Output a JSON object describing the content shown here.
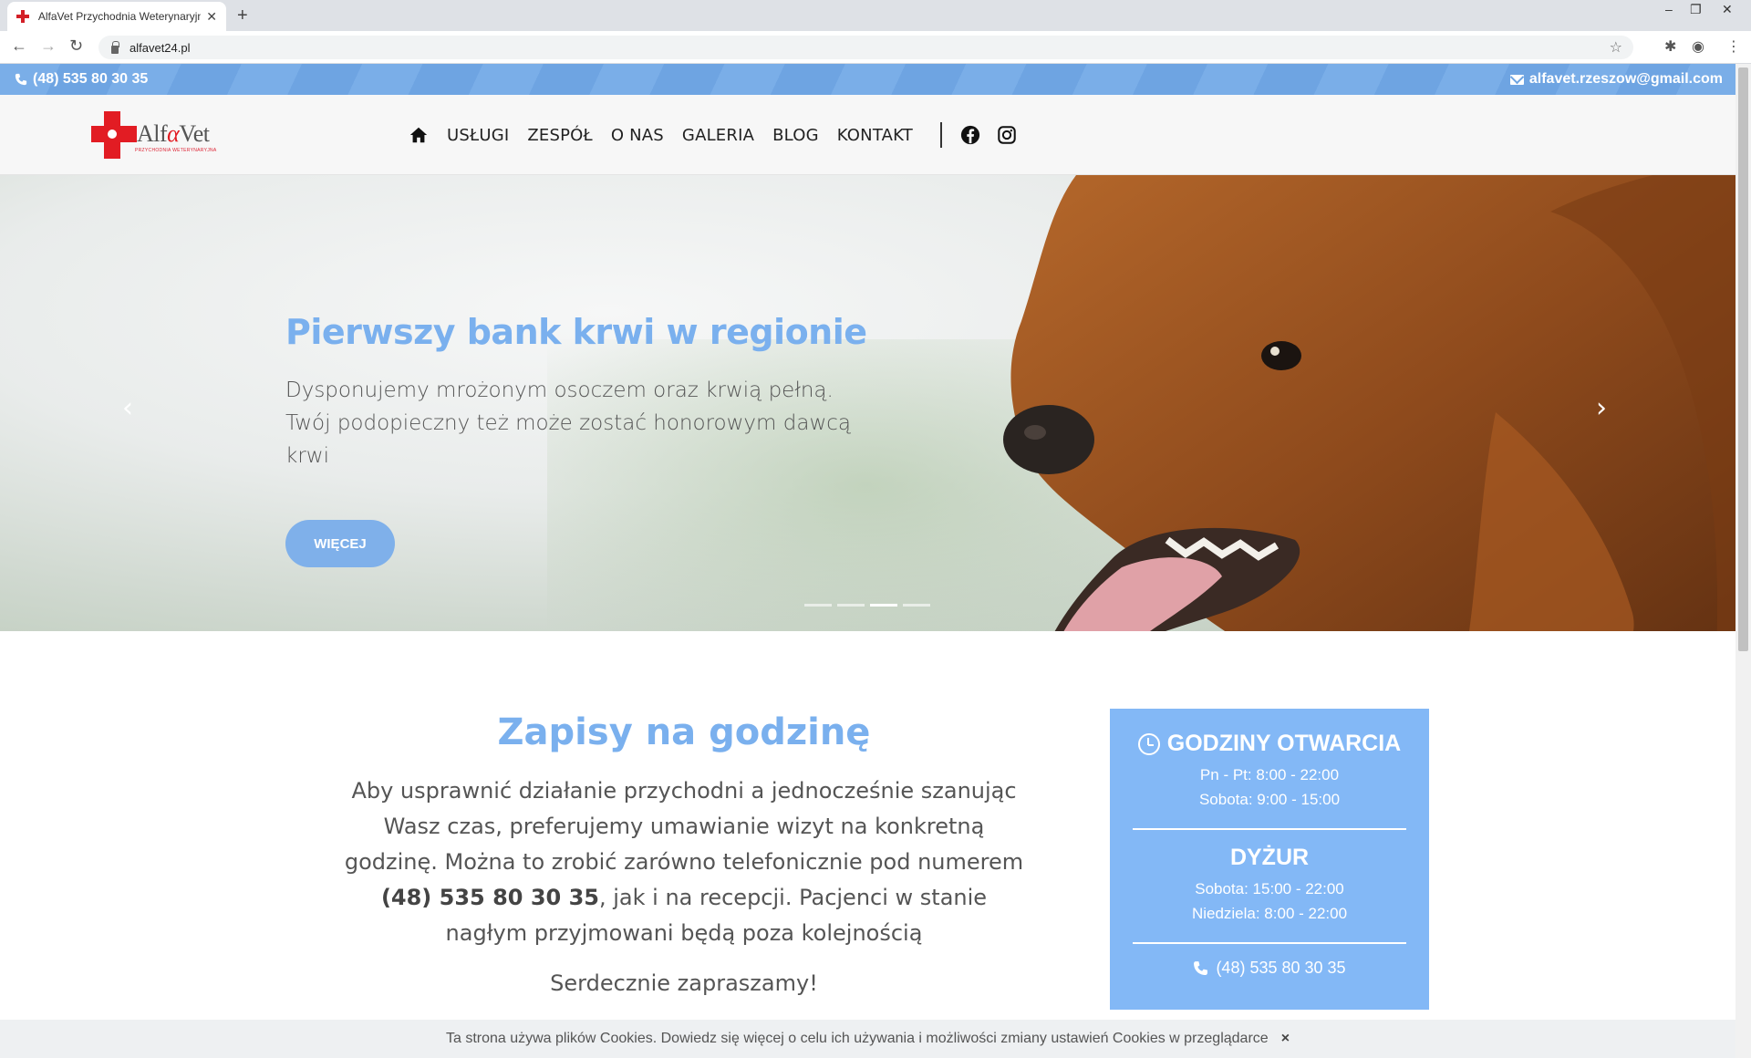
{
  "browser": {
    "tab_title": "AlfaVet Przychodnia Weterynaryjna",
    "url": "alfavet24.pl"
  },
  "topbar": {
    "phone": "(48) 535 80 30 35",
    "email": "alfavet.rzeszow@gmail.com",
    "color": "#6ea4e2"
  },
  "header": {
    "logo_name_start": "Alf",
    "logo_name_alpha": "α",
    "logo_name_end": "Vet",
    "logo_subtitle": "PRZYCHODNIA WETERYNARYJNA",
    "nav": [
      "USŁUGI",
      "ZESPÓŁ",
      "O NAS",
      "GALERIA",
      "BLOG",
      "KONTAKT"
    ]
  },
  "hero": {
    "title": "Pierwszy bank krwi w regionie",
    "text": "Dysponujemy mrożonym osoczem oraz krwią pełną. Twój podopieczny też może zostać honorowym dawcą krwi",
    "button": "WIĘCEJ",
    "slides_total": 4,
    "slide_active": 3,
    "accent": "#7ab0ee"
  },
  "booking": {
    "title": "Zapisy na godzinę",
    "text_before": "Aby usprawnić działanie przychodni a jednocześnie szanując Wasz czas, preferujemy umawianie wizyt na konkretną godzinę. Można to zrobić zarówno telefonicznie pod numerem ",
    "phone": "(48) 535 80 30 35",
    "text_after": ", jak i na recepcji. Pacjenci w stanie nagłym przyjmowani będą poza kolejnością",
    "invite": "Serdecznie zapraszamy!"
  },
  "hours": {
    "title": "GODZINY OTWARCIA",
    "weekdays": "Pn - Pt: 8:00 - 22:00",
    "saturday": "Sobota: 9:00 - 15:00",
    "duty_title": "DYŻUR",
    "duty_saturday": "Sobota: 15:00 - 22:00",
    "duty_sunday": "Niedziela: 8:00 - 22:00",
    "phone": "(48) 535 80 30 35",
    "background": "#83b8f6"
  },
  "cookie": {
    "text": "Ta strona używa plików Cookies. Dowiedz się więcej o celu ich używania i możliwości zmiany ustawień Cookies w przeglądarce",
    "close": "×"
  }
}
